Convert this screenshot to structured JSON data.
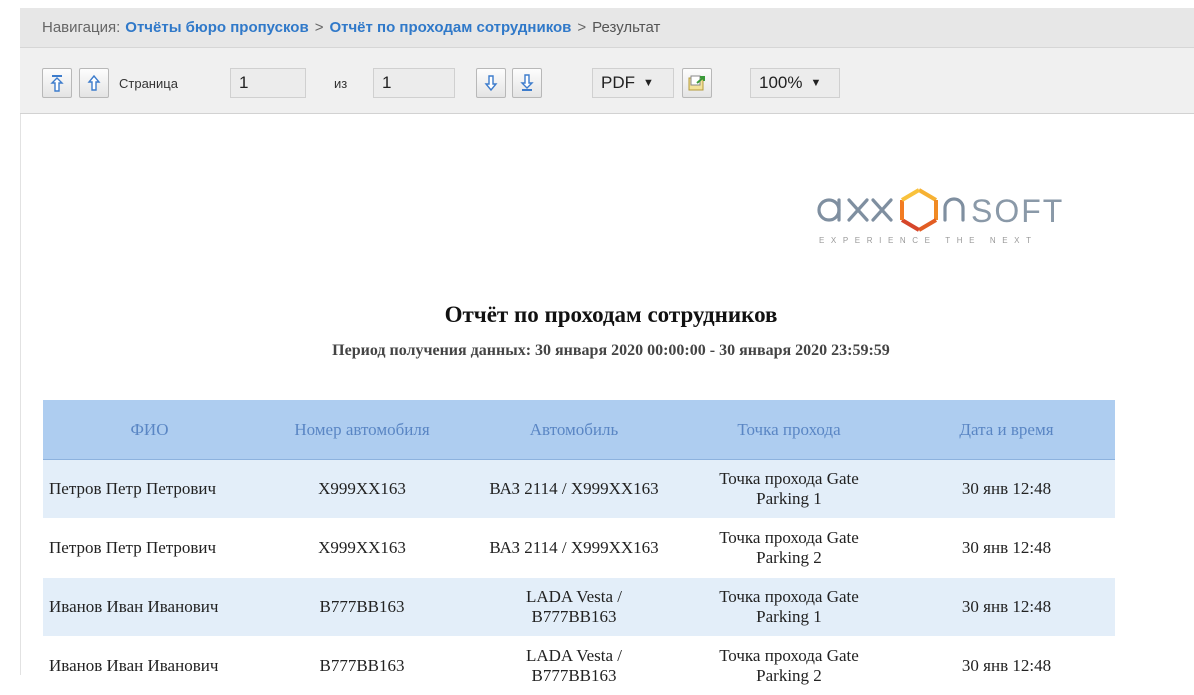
{
  "breadcrumb": {
    "label": "Навигация:",
    "items": [
      "Отчёты бюро пропусков",
      "Отчёт по проходам сотрудников",
      "Результат"
    ],
    "separator": ">"
  },
  "toolbar": {
    "page_label": "Страница",
    "page_value": "1",
    "of_label": "из",
    "total_pages": "1",
    "format_selected": "PDF",
    "zoom_selected": "100%",
    "icons": [
      "first-page-icon",
      "prev-page-icon",
      "next-page-icon",
      "last-page-icon",
      "export-icon"
    ]
  },
  "report": {
    "logo_text": "axxonsoft",
    "logo_tagline": "EXPERIENCE THE NEXT",
    "title": "Отчёт по проходам сотрудников",
    "period": "Период получения данных: 30 января 2020 00:00:00 - 30 января 2020 23:59:59",
    "columns": [
      "ФИО",
      "Номер автомобиля",
      "Автомобиль",
      "Точка прохода",
      "Дата и время"
    ],
    "rows": [
      [
        "Петров Петр Петрович",
        "X999XX163",
        "ВАЗ 2114 / X999XX163",
        "Точка прохода Gate Parking 1",
        "30 янв 12:48"
      ],
      [
        "Петров Петр Петрович",
        "X999XX163",
        "ВАЗ 2114 / X999XX163",
        "Точка прохода Gate Parking 2",
        "30 янв 12:48"
      ],
      [
        "Иванов Иван Иванович",
        "В777ВВ163",
        "LADA Vesta / В777ВВ163",
        "Точка прохода Gate Parking 1",
        "30 янв 12:48"
      ],
      [
        "Иванов Иван Иванович",
        "В777ВВ163",
        "LADA Vesta / В777ВВ163",
        "Точка прохода Gate Parking 2",
        "30 янв 12:48"
      ]
    ]
  },
  "colors": {
    "link": "#3079c9",
    "header_bg": "#aecdf0",
    "header_text": "#5a86c4",
    "row_alt_bg": "#e3eef9",
    "logo_orange": "#f08a24"
  }
}
